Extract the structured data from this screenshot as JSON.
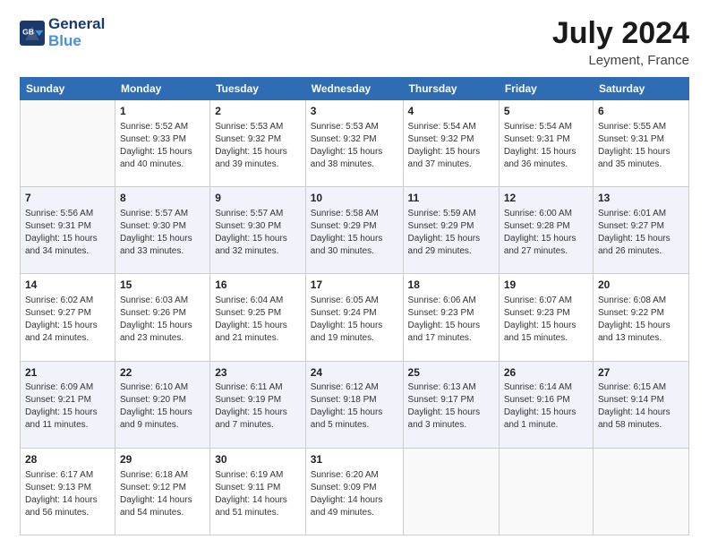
{
  "header": {
    "logo_line1": "General",
    "logo_line2": "Blue",
    "month": "July 2024",
    "location": "Leyment, France"
  },
  "weekdays": [
    "Sunday",
    "Monday",
    "Tuesday",
    "Wednesday",
    "Thursday",
    "Friday",
    "Saturday"
  ],
  "weeks": [
    [
      {
        "num": "",
        "info": ""
      },
      {
        "num": "1",
        "info": "Sunrise: 5:52 AM\nSunset: 9:33 PM\nDaylight: 15 hours\nand 40 minutes."
      },
      {
        "num": "2",
        "info": "Sunrise: 5:53 AM\nSunset: 9:32 PM\nDaylight: 15 hours\nand 39 minutes."
      },
      {
        "num": "3",
        "info": "Sunrise: 5:53 AM\nSunset: 9:32 PM\nDaylight: 15 hours\nand 38 minutes."
      },
      {
        "num": "4",
        "info": "Sunrise: 5:54 AM\nSunset: 9:32 PM\nDaylight: 15 hours\nand 37 minutes."
      },
      {
        "num": "5",
        "info": "Sunrise: 5:54 AM\nSunset: 9:31 PM\nDaylight: 15 hours\nand 36 minutes."
      },
      {
        "num": "6",
        "info": "Sunrise: 5:55 AM\nSunset: 9:31 PM\nDaylight: 15 hours\nand 35 minutes."
      }
    ],
    [
      {
        "num": "7",
        "info": "Sunrise: 5:56 AM\nSunset: 9:31 PM\nDaylight: 15 hours\nand 34 minutes."
      },
      {
        "num": "8",
        "info": "Sunrise: 5:57 AM\nSunset: 9:30 PM\nDaylight: 15 hours\nand 33 minutes."
      },
      {
        "num": "9",
        "info": "Sunrise: 5:57 AM\nSunset: 9:30 PM\nDaylight: 15 hours\nand 32 minutes."
      },
      {
        "num": "10",
        "info": "Sunrise: 5:58 AM\nSunset: 9:29 PM\nDaylight: 15 hours\nand 30 minutes."
      },
      {
        "num": "11",
        "info": "Sunrise: 5:59 AM\nSunset: 9:29 PM\nDaylight: 15 hours\nand 29 minutes."
      },
      {
        "num": "12",
        "info": "Sunrise: 6:00 AM\nSunset: 9:28 PM\nDaylight: 15 hours\nand 27 minutes."
      },
      {
        "num": "13",
        "info": "Sunrise: 6:01 AM\nSunset: 9:27 PM\nDaylight: 15 hours\nand 26 minutes."
      }
    ],
    [
      {
        "num": "14",
        "info": "Sunrise: 6:02 AM\nSunset: 9:27 PM\nDaylight: 15 hours\nand 24 minutes."
      },
      {
        "num": "15",
        "info": "Sunrise: 6:03 AM\nSunset: 9:26 PM\nDaylight: 15 hours\nand 23 minutes."
      },
      {
        "num": "16",
        "info": "Sunrise: 6:04 AM\nSunset: 9:25 PM\nDaylight: 15 hours\nand 21 minutes."
      },
      {
        "num": "17",
        "info": "Sunrise: 6:05 AM\nSunset: 9:24 PM\nDaylight: 15 hours\nand 19 minutes."
      },
      {
        "num": "18",
        "info": "Sunrise: 6:06 AM\nSunset: 9:23 PM\nDaylight: 15 hours\nand 17 minutes."
      },
      {
        "num": "19",
        "info": "Sunrise: 6:07 AM\nSunset: 9:23 PM\nDaylight: 15 hours\nand 15 minutes."
      },
      {
        "num": "20",
        "info": "Sunrise: 6:08 AM\nSunset: 9:22 PM\nDaylight: 15 hours\nand 13 minutes."
      }
    ],
    [
      {
        "num": "21",
        "info": "Sunrise: 6:09 AM\nSunset: 9:21 PM\nDaylight: 15 hours\nand 11 minutes."
      },
      {
        "num": "22",
        "info": "Sunrise: 6:10 AM\nSunset: 9:20 PM\nDaylight: 15 hours\nand 9 minutes."
      },
      {
        "num": "23",
        "info": "Sunrise: 6:11 AM\nSunset: 9:19 PM\nDaylight: 15 hours\nand 7 minutes."
      },
      {
        "num": "24",
        "info": "Sunrise: 6:12 AM\nSunset: 9:18 PM\nDaylight: 15 hours\nand 5 minutes."
      },
      {
        "num": "25",
        "info": "Sunrise: 6:13 AM\nSunset: 9:17 PM\nDaylight: 15 hours\nand 3 minutes."
      },
      {
        "num": "26",
        "info": "Sunrise: 6:14 AM\nSunset: 9:16 PM\nDaylight: 15 hours\nand 1 minute."
      },
      {
        "num": "27",
        "info": "Sunrise: 6:15 AM\nSunset: 9:14 PM\nDaylight: 14 hours\nand 58 minutes."
      }
    ],
    [
      {
        "num": "28",
        "info": "Sunrise: 6:17 AM\nSunset: 9:13 PM\nDaylight: 14 hours\nand 56 minutes."
      },
      {
        "num": "29",
        "info": "Sunrise: 6:18 AM\nSunset: 9:12 PM\nDaylight: 14 hours\nand 54 minutes."
      },
      {
        "num": "30",
        "info": "Sunrise: 6:19 AM\nSunset: 9:11 PM\nDaylight: 14 hours\nand 51 minutes."
      },
      {
        "num": "31",
        "info": "Sunrise: 6:20 AM\nSunset: 9:09 PM\nDaylight: 14 hours\nand 49 minutes."
      },
      {
        "num": "",
        "info": ""
      },
      {
        "num": "",
        "info": ""
      },
      {
        "num": "",
        "info": ""
      }
    ]
  ]
}
